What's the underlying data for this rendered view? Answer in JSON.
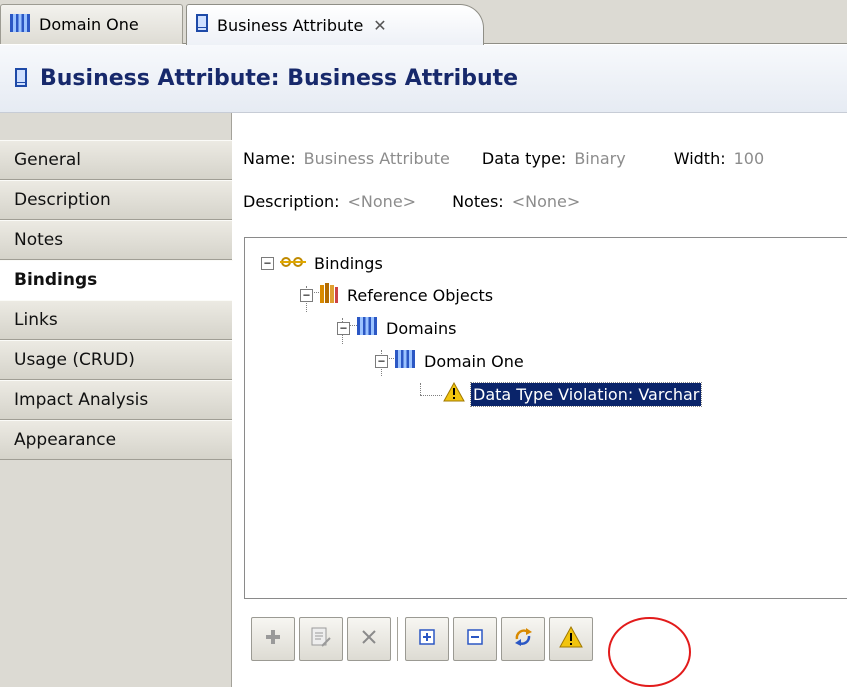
{
  "tabs": [
    {
      "label": "Domain One",
      "icon": "domain-icon"
    },
    {
      "label": "Business Attribute",
      "icon": "business-attribute-icon",
      "close": "✕"
    }
  ],
  "header": {
    "title": "Business Attribute: Business Attribute",
    "icon": "business-attribute-icon"
  },
  "nav": {
    "items": [
      "General",
      "Description",
      "Notes",
      "Bindings",
      "Links",
      "Usage (CRUD)",
      "Impact Analysis",
      "Appearance"
    ],
    "selected": "Bindings"
  },
  "props": {
    "name_label": "Name:",
    "name_value": "Business Attribute",
    "datatype_label": "Data type:",
    "datatype_value": "Binary",
    "width_label": "Width:",
    "width_value": "100",
    "description_label": "Description:",
    "description_value": "<None>",
    "notes_label": "Notes:",
    "notes_value": "<None>"
  },
  "tree": {
    "root": "Bindings",
    "reference_objects": "Reference Objects",
    "domains": "Domains",
    "domain_one": "Domain One",
    "violation": "Data Type Violation: Varchar"
  },
  "toolbar": {
    "buttons": [
      "add-icon",
      "edit-icon",
      "delete-icon",
      "expand-all-icon",
      "collapse-all-icon",
      "refresh-icon",
      "warning-icon"
    ]
  },
  "colors": {
    "header_title": "#17296b",
    "selection": "#0a246a",
    "highlight_circle": "#e21b1b",
    "warning": "#e8b400"
  }
}
